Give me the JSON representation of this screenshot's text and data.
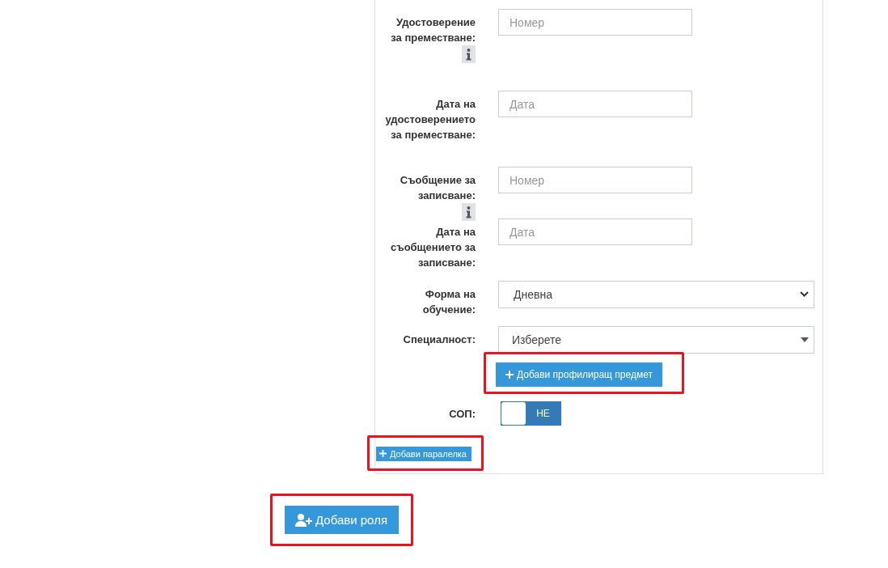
{
  "form": {
    "rows": [
      {
        "kind": "text",
        "label": "Удостоверение за преместване:",
        "info": true,
        "placeholder": "Номер"
      },
      {
        "kind": "text",
        "label": "Дата на удостоверението за преместване:",
        "info": false,
        "placeholder": "Дата"
      },
      {
        "kind": "text",
        "label": "Съобщение за записване:",
        "info": true,
        "placeholder": "Номер"
      },
      {
        "kind": "text",
        "label": "Дата на съобщението за записване:",
        "info": false,
        "placeholder": "Дата"
      },
      {
        "kind": "native-select",
        "label": "Форма на обучение:",
        "value": "Дневна"
      },
      {
        "kind": "custom-select",
        "label": "Специалност:",
        "value": "Изберете"
      }
    ],
    "profile_button": {
      "label": "Добави профилиращ предмет",
      "highlighted": true
    },
    "sop": {
      "label": "СОП:",
      "on": false,
      "state_text": "НЕ"
    },
    "class_button": {
      "label": "Добави паралелка",
      "highlighted": true
    }
  },
  "role_button": {
    "label": "Добави роля",
    "highlighted": true
  }
}
